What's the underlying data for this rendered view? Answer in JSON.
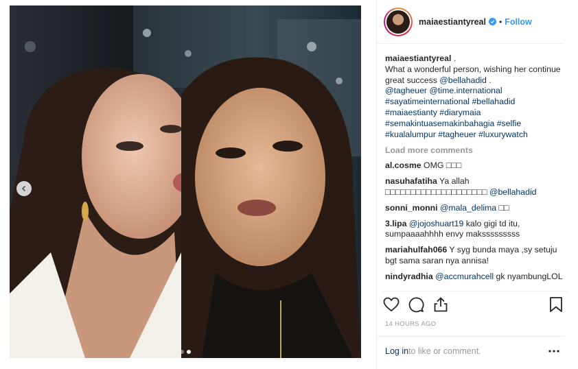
{
  "post": {
    "username": "maiaestiantyreal",
    "follow_label": "Follow",
    "separator": "•",
    "caption": {
      "username": "maiaestiantyreal",
      "text_1": ".",
      "text_2": "What a wonderful person, wishing her continue great success ",
      "mention_1": "@bellahadid",
      "text_3": " .",
      "mention_2": "@tagheuer",
      "mention_3": "@time.international",
      "tags_1": "#sayatimeinternational #bellahadid",
      "tags_2": "#maiaestianty #diarymaia",
      "tags_3": "#semakintuasemakinbahagia #selfie",
      "tags_4": "#kualalumpur #tagheuer #luxurywatch"
    },
    "load_more_label": "Load more comments",
    "comments": [
      {
        "user": "al.cosme",
        "text": " OMG □□□"
      },
      {
        "user": "nasuhafatiha",
        "text": " Ya allah □□□□□□□□□□□□□□□□□□□□ ",
        "mention": "@bellahadid"
      },
      {
        "user": "sonni_monni",
        "text": " ",
        "mention": "@mala_delima",
        "text_after": " □□"
      },
      {
        "user": "3.lipa",
        "text": " ",
        "mention": "@jojoshuart19",
        "text_after": " kalo gigi td itu, sumpaaaahhhh envy maksssssssss"
      },
      {
        "user": "mariahulfah066",
        "text": " Y syg bunda maya ,sy setuju bgt sama saran nya annisa!"
      },
      {
        "user": "nindyradhia",
        "text": " ",
        "mention": "@accmurahcell",
        "text_after": " gk nyambungLOL"
      }
    ],
    "timestamp": "14 HOURS AGO",
    "footer": {
      "login_label": "Log in",
      "rest": " to like or comment."
    }
  },
  "icons": {
    "verified": "verified-badge-icon",
    "like": "heart-icon",
    "comment": "comment-bubble-icon",
    "share": "share-icon",
    "save": "bookmark-icon",
    "more": "more-dots-icon",
    "prev": "chevron-left-icon"
  },
  "colors": {
    "link": "#003569",
    "follow": "#3897f0",
    "muted": "#999999",
    "verified": "#3897f0"
  },
  "carousel": {
    "total": 2,
    "active": 2
  }
}
